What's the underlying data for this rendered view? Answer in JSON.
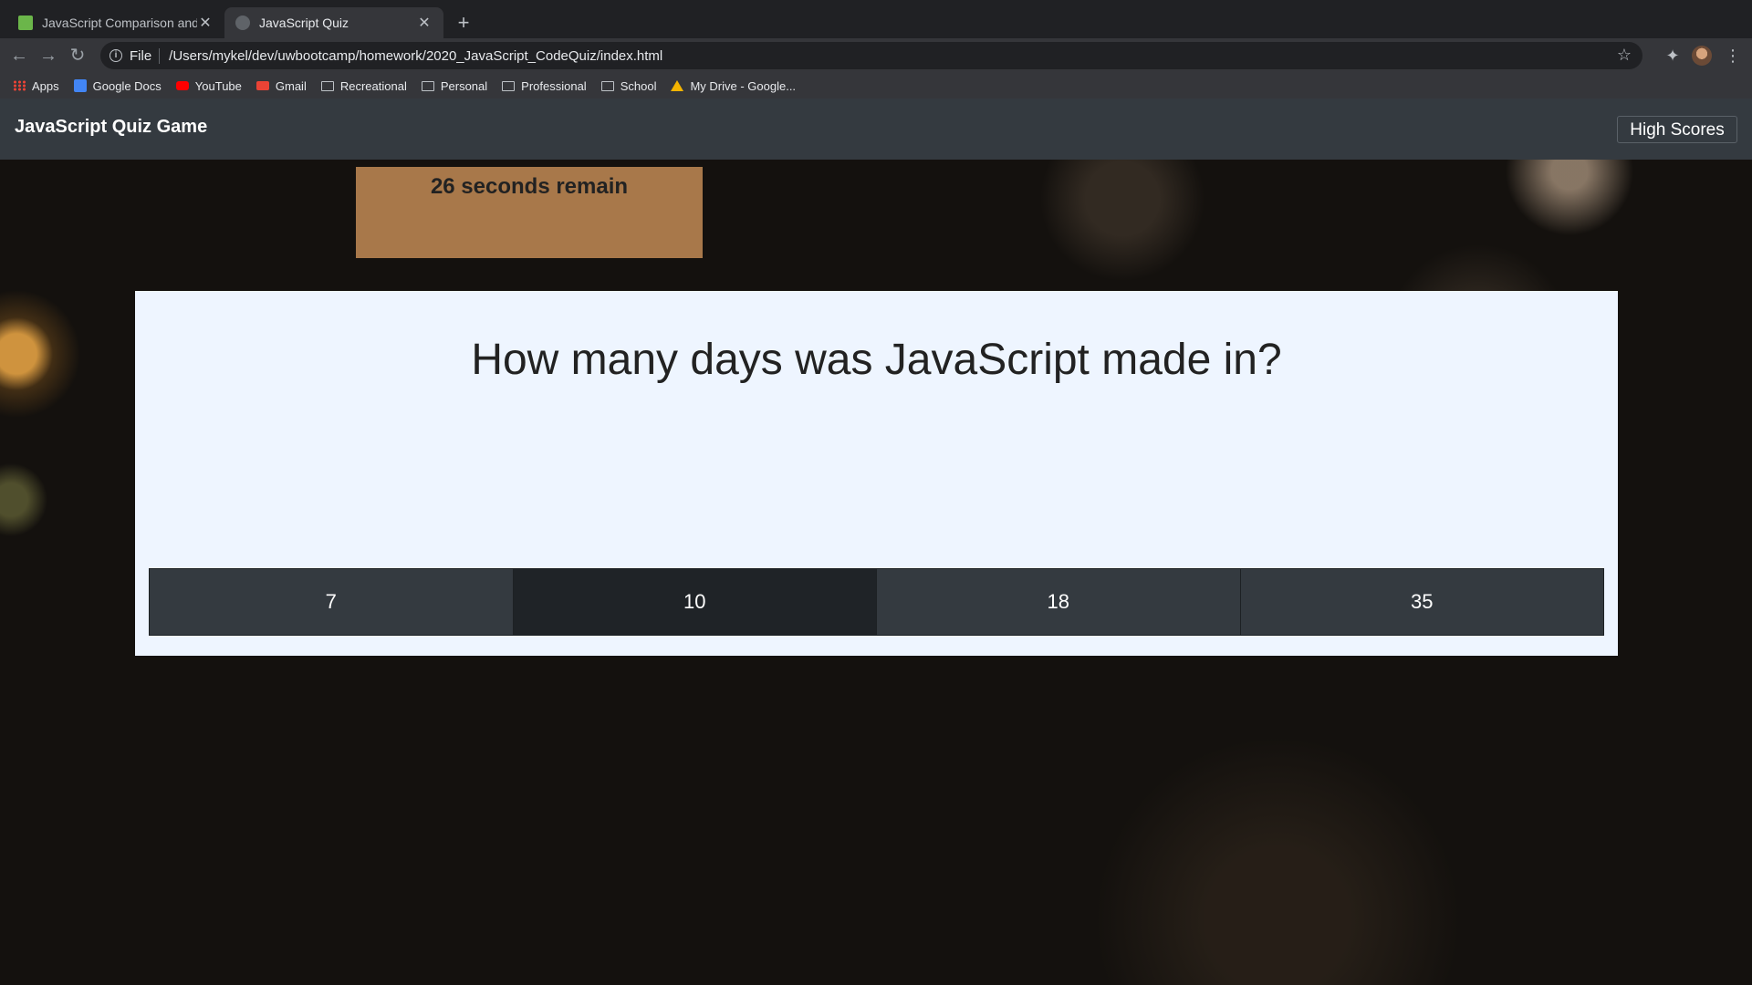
{
  "browser": {
    "tabs": [
      {
        "title": "JavaScript Comparison and Lo",
        "active": false
      },
      {
        "title": "JavaScript Quiz",
        "active": true
      }
    ],
    "address": {
      "scheme_label": "File",
      "url": "/Users/mykel/dev/uwbootcamp/homework/2020_JavaScript_CodeQuiz/index.html"
    },
    "bookmarks": [
      {
        "label": "Apps",
        "icon": "apps-icon"
      },
      {
        "label": "Google Docs",
        "icon": "docs-icon"
      },
      {
        "label": "YouTube",
        "icon": "youtube-icon"
      },
      {
        "label": "Gmail",
        "icon": "gmail-icon"
      },
      {
        "label": "Recreational",
        "icon": "folder-icon"
      },
      {
        "label": "Personal",
        "icon": "folder-icon"
      },
      {
        "label": "Professional",
        "icon": "folder-icon"
      },
      {
        "label": "School",
        "icon": "folder-icon"
      },
      {
        "label": "My Drive - Google...",
        "icon": "drive-icon"
      }
    ]
  },
  "app": {
    "brand": "JavaScript Quiz Game",
    "high_scores_label": "High Scores",
    "timer_text": "26 seconds remain",
    "question": "How many days was JavaScript made in?",
    "answers": [
      "7",
      "10",
      "18",
      "35"
    ]
  },
  "colors": {
    "navbar": "#343a40",
    "timer_bg": "#a8784a",
    "card_bg": "#eef5ff",
    "answer_bg": "#343a40"
  }
}
